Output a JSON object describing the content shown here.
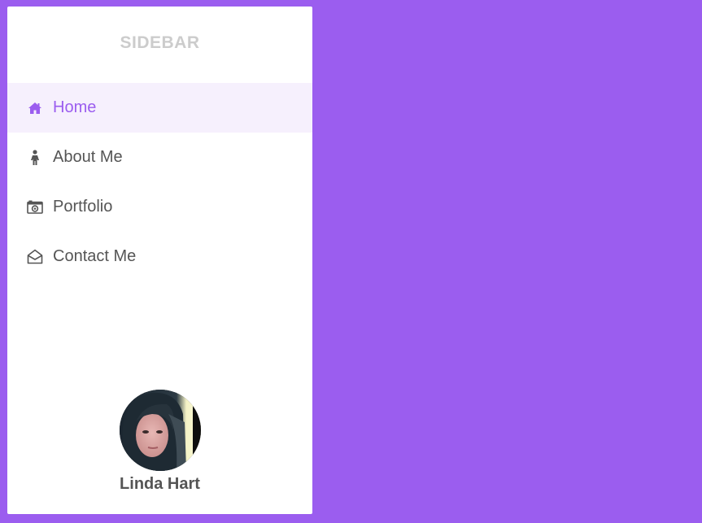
{
  "sidebar": {
    "title": "SIDEBAR",
    "items": [
      {
        "label": "Home",
        "icon": "home-icon",
        "active": true
      },
      {
        "label": "About Me",
        "icon": "person-icon",
        "active": false
      },
      {
        "label": "Portfolio",
        "icon": "camera-icon",
        "active": false
      },
      {
        "label": "Contact Me",
        "icon": "envelope-open-icon",
        "active": false
      }
    ]
  },
  "profile": {
    "name": "Linda Hart",
    "avatar": "user-avatar-photo"
  },
  "colors": {
    "background": "#9b5def",
    "accent": "#9b5def",
    "active_item_bg": "#f6f0fd",
    "text": "#555555",
    "title": "#cccccc"
  }
}
